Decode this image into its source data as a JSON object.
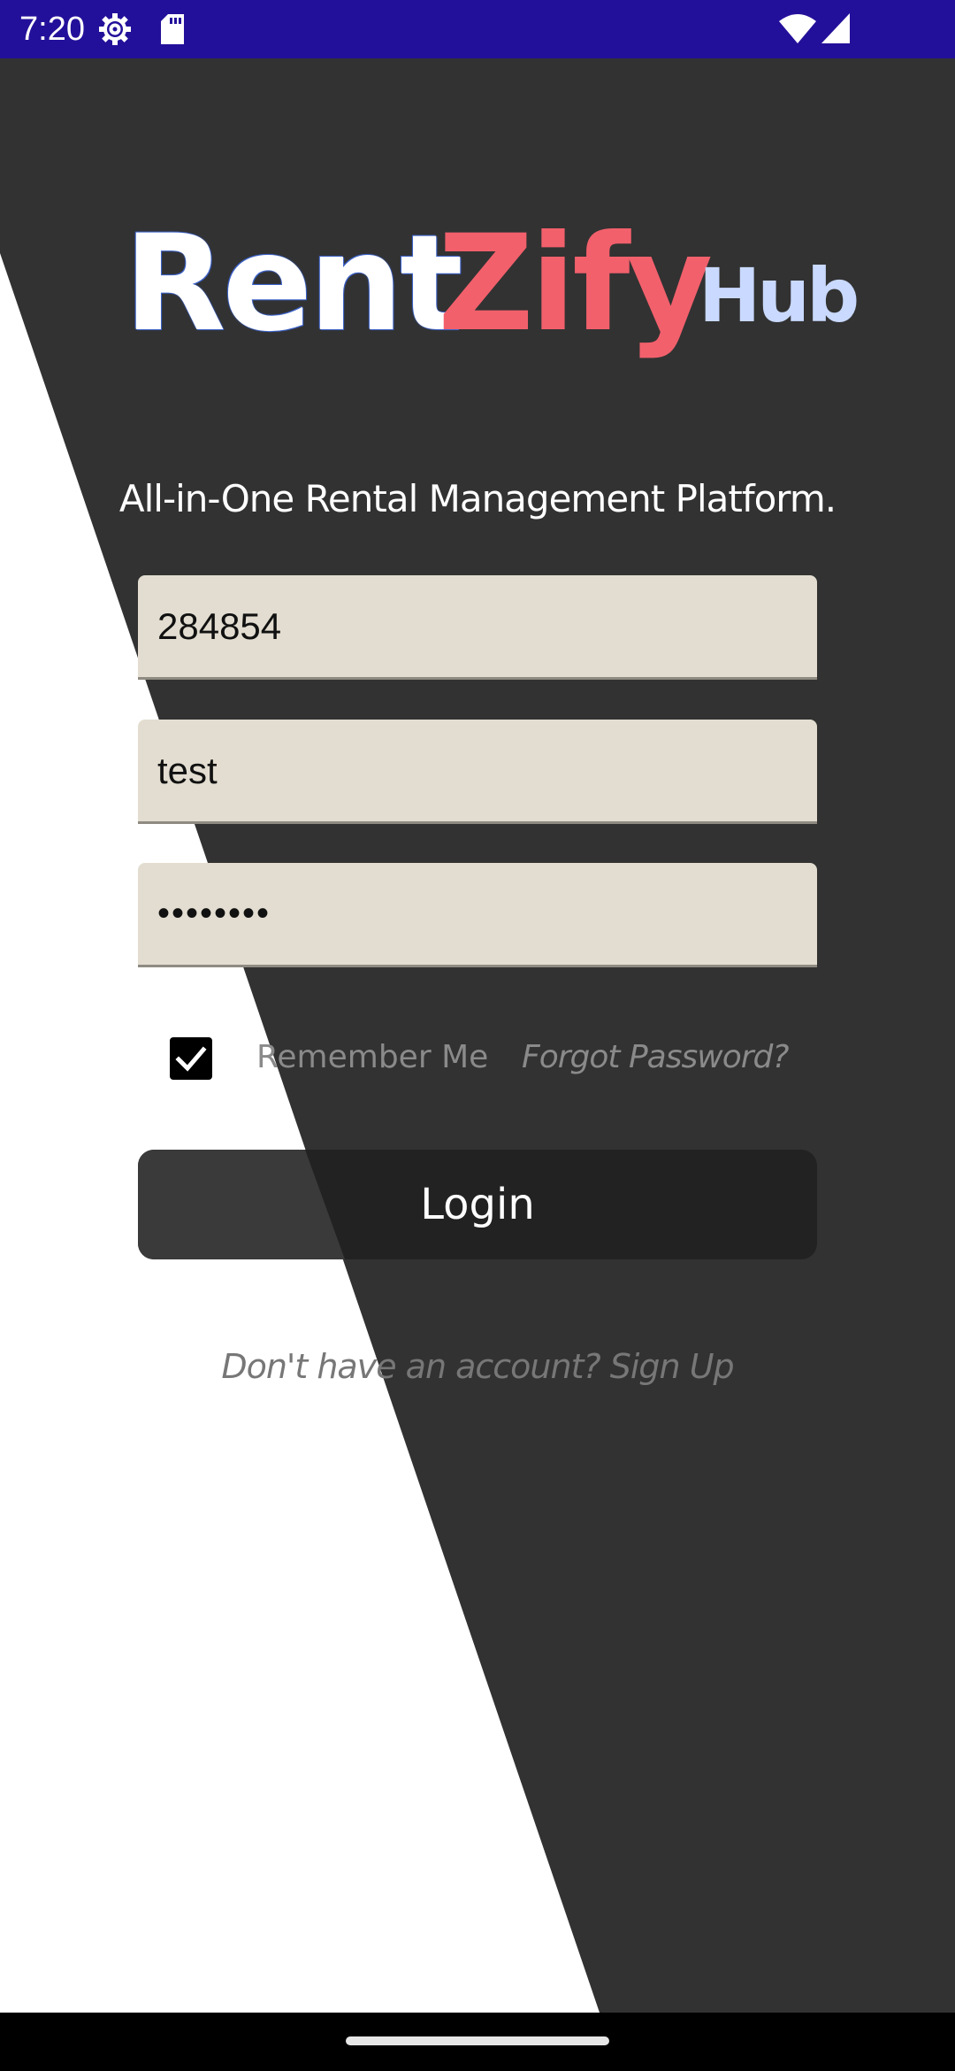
{
  "status_bar": {
    "time": "7:20",
    "icons": [
      "settings-icon",
      "sd-card-icon",
      "wifi-icon",
      "signal-icon"
    ],
    "color": "#23109a"
  },
  "logo": {
    "part1": "Rent",
    "part2": "Zify",
    "part3": "Hub",
    "colors": {
      "part1": "#ffffff",
      "part2": "#f2606c",
      "part3": "#c9d9ff"
    }
  },
  "tagline": "All-in-One Rental Management Platform.",
  "form": {
    "field1_value": "284854",
    "field2_value": "test",
    "password_value": "••••••••",
    "remember_checked": true,
    "remember_label": "Remember Me",
    "forgot_label": "Forgot Password?",
    "login_label": "Login",
    "signup_label": "Don't have an account? Sign Up"
  },
  "colors": {
    "background_dark": "#323232",
    "background_light": "#ffffff",
    "field_bg": "#e2ddd0",
    "button_bg": "#222222"
  }
}
